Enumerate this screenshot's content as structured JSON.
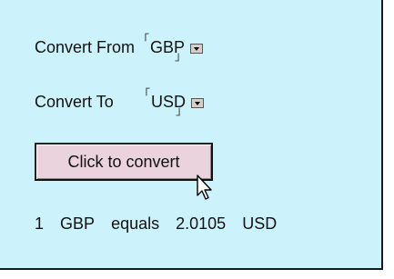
{
  "converter": {
    "from_label": "Convert From",
    "from_value": "GBP",
    "to_label": "Convert To",
    "to_value": "USD",
    "button_label": "Click to convert"
  },
  "result": {
    "amount": "1",
    "from_currency": "GBP",
    "equals_text": "equals",
    "converted_value": "2.0105",
    "to_currency": "USD"
  },
  "colors": {
    "panel_background": "#ccf3fb",
    "button_background": "#ead3dc"
  },
  "icons": [
    "chevron-down-icon",
    "mouse-pointer-icon"
  ]
}
